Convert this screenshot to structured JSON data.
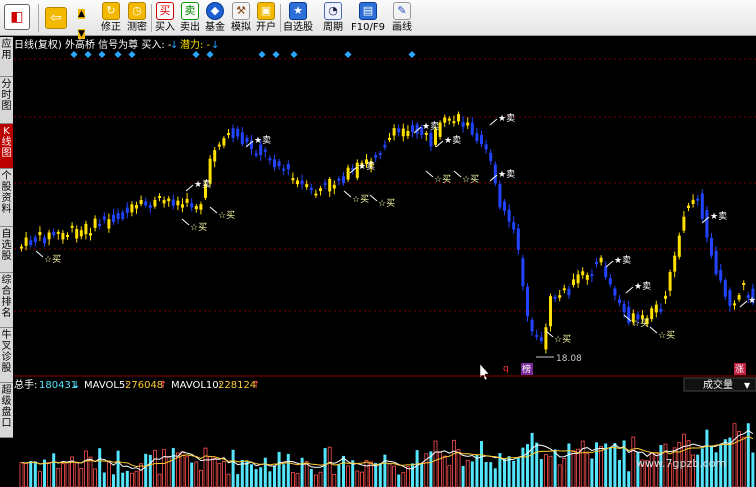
{
  "toolbar": {
    "buttons": [
      {
        "key": "xiuzheng",
        "label": "修正",
        "icon": "refresh-icon"
      },
      {
        "key": "cemi",
        "label": "测密",
        "icon": "clock-icon"
      },
      {
        "key": "mairu",
        "label": "买入",
        "icon": "buy-icon",
        "glyph": "买"
      },
      {
        "key": "maichu",
        "label": "卖出",
        "icon": "sell-icon",
        "glyph": "卖"
      },
      {
        "key": "jijin",
        "label": "基金",
        "icon": "fund-icon"
      },
      {
        "key": "moni",
        "label": "模拟",
        "icon": "gavel-icon"
      },
      {
        "key": "kaihu",
        "label": "开户",
        "icon": "lock-icon"
      },
      {
        "key": "zixuangu",
        "label": "自选股",
        "icon": "star-folder-icon"
      },
      {
        "key": "zhouqi",
        "label": "周期",
        "icon": "period-clock-icon"
      },
      {
        "key": "f10",
        "label": "F10/F9",
        "icon": "f10-icon"
      },
      {
        "key": "huaxian",
        "label": "画线",
        "icon": "pencil-icon"
      }
    ]
  },
  "side_tabs": [
    "应用",
    "分时图",
    "K线图",
    "个股资料",
    "自选股",
    "综合排名",
    "牛叉诊股",
    "超级盘口"
  ],
  "chart": {
    "header_text": "日线(复权)  外高桥 信号为尊 买入: -",
    "header_arrow": "↓",
    "header_sell_label": "潜力: -",
    "header_sell_arrow": "↓",
    "low_price_label": "18.08",
    "buy_label": "☆买",
    "sell_label": "★卖",
    "markers": [
      "q",
      "榜",
      "涨"
    ]
  },
  "volume": {
    "total_label": "总手:",
    "total_value": "180431",
    "total_arrow": "↓",
    "mavol5_label": "MAVOL5:",
    "mavol5_value": "276048",
    "mavol5_arrow": "↑",
    "mavol10_label": "MAVOL10:",
    "mavol10_value": "228124",
    "mavol10_arrow": "↑",
    "dropdown_value": "成交量"
  },
  "watermark": "www.7gpzb.com",
  "colors": {
    "up": "#ffe000",
    "down": "#2244ff",
    "vol_up": "#ff5050",
    "vol_down": "#55e6ff",
    "ma5": "#ffffff",
    "ma10": "#ffcc33",
    "grid": "#7a0000",
    "signal": "#2aa7ff"
  }
}
